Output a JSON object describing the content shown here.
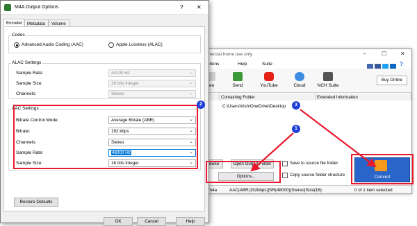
{
  "background_app": {
    "title_fragment": "mercial home use only",
    "menu": {
      "options": "ptions",
      "help": "Help",
      "suite": "Suite"
    },
    "buy_online": "Buy Online",
    "toolbar": [
      {
        "key": "video",
        "label": "deo"
      },
      {
        "key": "send",
        "label": "Send"
      },
      {
        "key": "youtube",
        "label": "YouTube"
      },
      {
        "key": "cloud",
        "label": "Cloud"
      },
      {
        "key": "nch_suite",
        "label": "NCH Suite"
      }
    ],
    "columns": {
      "containing_folder": "Containing Folder",
      "extended_information": "Extended Information"
    },
    "row": {
      "folder": "C:\\Users\\trish\\OneDrive\\Desktop"
    },
    "buttons": {
      "browse": "owse",
      "open_output_folder": "Open Output Folder",
      "options": "Options..."
    },
    "checkboxes": {
      "save_to_source": "Save to source file folder",
      "copy_structure": "Copy source folder structure"
    },
    "convert": "Convert",
    "status": {
      "format": ".m4a",
      "details": "AAC|ABR(192kbps)|SR(48000)|Stereo|Size(16)",
      "selection": "0 of 1 item selected"
    }
  },
  "dialog": {
    "title": "M4A Output Options",
    "help_glyph": "?",
    "close_glyph": "✕",
    "tabs": [
      "Encoder",
      "Metadata",
      "Volume"
    ],
    "codec": {
      "group_label": "Codec",
      "options": [
        "Advanced Audio Coding (AAC)",
        "Apple Lossless (ALAC)"
      ],
      "selected": "Advanced Audio Coding (AAC)"
    },
    "alac": {
      "group_label": "ALAC Settings",
      "sample_rate": {
        "label": "Sample Rate:",
        "value": "44100 Hz"
      },
      "sample_size": {
        "label": "Sample Size:",
        "value": "16 bits Integer"
      },
      "channels": {
        "label": "Channels:",
        "value": "Stereo"
      }
    },
    "aac": {
      "group_label": "AAC Settings",
      "bitrate_mode": {
        "label": "Bitrate Control Mode:",
        "value": "Average Bitrate (ABR)"
      },
      "bitrate": {
        "label": "Bitrate:",
        "value": "192 kbps"
      },
      "channels": {
        "label": "Channels:",
        "value": "Stereo"
      },
      "sample_rate": {
        "label": "Sample Rate:",
        "value": "48000 Hz"
      },
      "sample_size": {
        "label": "Sample Size:",
        "value": "16 bits Integer"
      }
    },
    "restore_defaults": "Restore Defaults",
    "ok": "OK",
    "cancel": "Cancel",
    "help": "Help"
  },
  "callouts": [
    {
      "n": "1",
      "color": "#1e40d8"
    },
    {
      "n": "2",
      "color": "#1e40d8"
    },
    {
      "n": "3",
      "color": "#1e40d8"
    }
  ],
  "colors": {
    "highlight": "#e8192c",
    "convert_bg": "#2a66c9",
    "selected_text_bg": "#0078d7"
  }
}
